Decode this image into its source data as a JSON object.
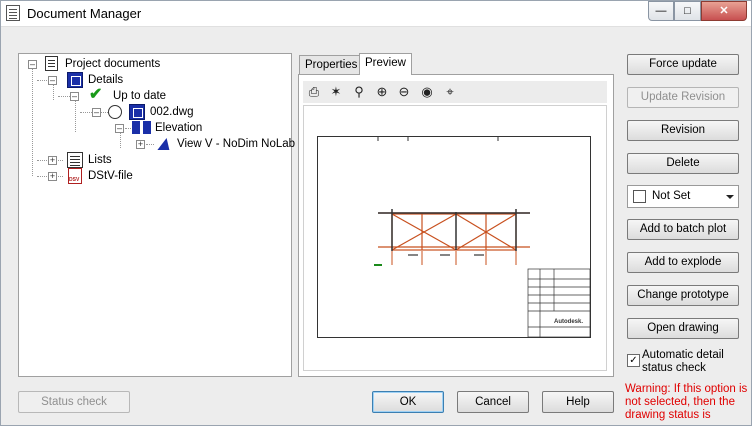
{
  "window": {
    "title": "Document Manager"
  },
  "tree": {
    "root": "Project documents",
    "details": "Details",
    "up_to_date": "Up to date",
    "dwg": "002.dwg",
    "elevation": "Elevation",
    "view": "View V - NoDim NoLab",
    "lists": "Lists",
    "dstv": "DStV-file"
  },
  "tabs": [
    {
      "label": "Properties",
      "active": false
    },
    {
      "label": "Preview",
      "active": true
    }
  ],
  "preview_toolbar": [
    "print-icon",
    "pan-icon",
    "zoom-realtime-icon",
    "zoom-in-icon",
    "zoom-out-icon",
    "zoom-window-icon",
    "zoom-extents-icon"
  ],
  "preview_drawing": {
    "title_block_text": "Autodesk."
  },
  "actions": {
    "force_update": "Force update",
    "update_revision": "Update Revision",
    "revision": "Revision",
    "delete": "Delete",
    "status_select": "Not Set",
    "add_batch_plot": "Add to batch plot",
    "add_explode": "Add to explode",
    "change_prototype": "Change prototype",
    "open_drawing": "Open drawing"
  },
  "auto_check": {
    "label": "Automatic detail status check",
    "checked": true
  },
  "warning": "Warning: If this option is not selected, then the drawing status is",
  "bottom": {
    "status_check": "Status check",
    "ok": "OK",
    "cancel": "Cancel",
    "help": "Help"
  },
  "colors": {
    "warning": "#e00000",
    "drawing_member": "#c8501e",
    "icon_blue": "#1a2fa8"
  }
}
